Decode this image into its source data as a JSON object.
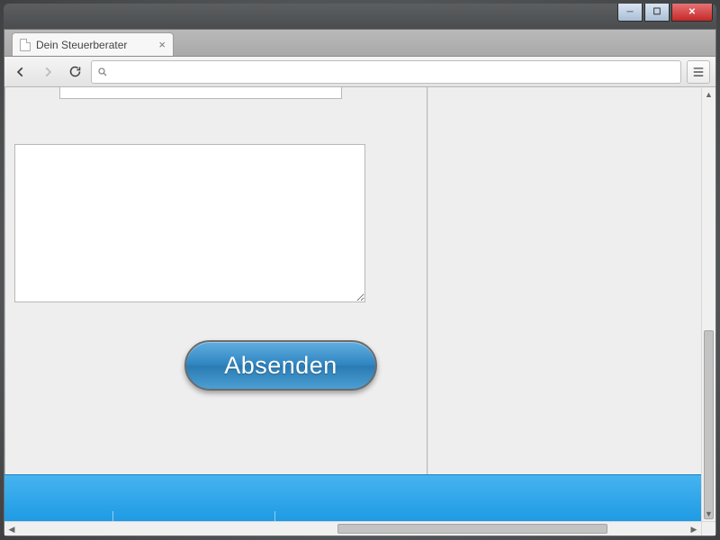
{
  "window": {
    "controls": {
      "min": "🗕",
      "max": "☐",
      "close": "✕"
    }
  },
  "browser": {
    "tab_title": "Dein Steuerberater",
    "address": ""
  },
  "form": {
    "input_value": "",
    "textarea_value": "",
    "submit_label": "Absenden"
  }
}
